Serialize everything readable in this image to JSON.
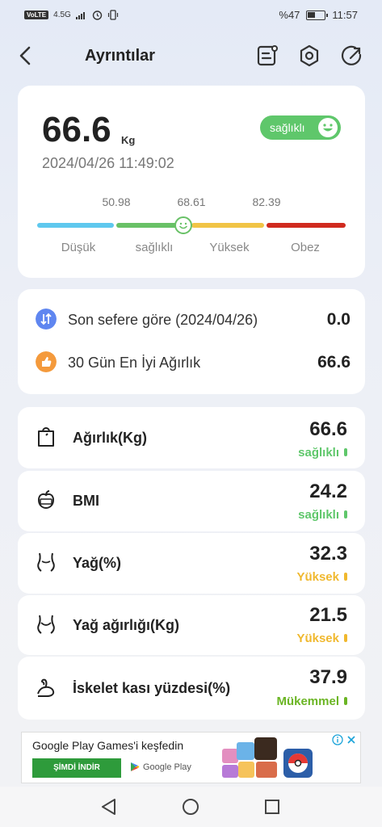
{
  "statusbar": {
    "network": "VoLTE",
    "signal": "4.5G",
    "battery_text": "%47",
    "battery_level": 0.47,
    "time": "11:57"
  },
  "header": {
    "title": "Ayrıntılar",
    "icons": [
      "back-arrow-icon",
      "report-icon",
      "settings-icon",
      "share-icon"
    ]
  },
  "summary": {
    "weight": "66.6",
    "unit": "Kg",
    "datetime": "2024/04/26 11:49:02",
    "status": "sağlıklı",
    "status_color": "#5fc76b",
    "scale_values": [
      "50.98",
      "68.61",
      "82.39"
    ],
    "ranges": [
      {
        "label": "Düşük",
        "color": "#5ec8ee"
      },
      {
        "label": "sağlıklı",
        "color": "#68c166"
      },
      {
        "label": "Yüksek",
        "color": "#f1c445"
      },
      {
        "label": "Obez",
        "color": "#d02a1f"
      }
    ]
  },
  "comparison": [
    {
      "label": "Son sefere göre (2024/04/26)",
      "value": "0.0",
      "icon": "compare-icon",
      "icon_color": "#5f86f0"
    },
    {
      "label": "30 Gün En İyi Ağırlık",
      "value": "66.6",
      "icon": "thumbs-up-icon",
      "icon_color": "#f49a3c"
    }
  ],
  "metrics": [
    {
      "label": "Ağırlık(Kg)",
      "value": "66.6",
      "status": "sağlıklı",
      "status_color": "#5fc76b",
      "icon": "scale-icon"
    },
    {
      "label": "BMI",
      "value": "24.2",
      "status": "sağlıklı",
      "status_color": "#5fc76b",
      "icon": "bmi-icon"
    },
    {
      "label": "Yağ(%)",
      "value": "32.3",
      "status": "Yüksek",
      "status_color": "#f0b82e",
      "icon": "body-fat-icon"
    },
    {
      "label": "Yağ ağırlığı(Kg)",
      "value": "21.5",
      "status": "Yüksek",
      "status_color": "#f0b82e",
      "icon": "fat-mass-icon"
    },
    {
      "label": "İskelet kası yüzdesi(%)",
      "value": "37.9",
      "status": "Mükemmel",
      "status_color": "#6bb524",
      "icon": "muscle-icon"
    }
  ],
  "ad": {
    "title": "Google Play Games'i keşfedin",
    "button": "ŞİMDİ İNDİR",
    "store": "Google Play"
  },
  "navbar": {
    "icons": [
      "back-triangle-icon",
      "home-circle-icon",
      "recents-square-icon"
    ]
  }
}
